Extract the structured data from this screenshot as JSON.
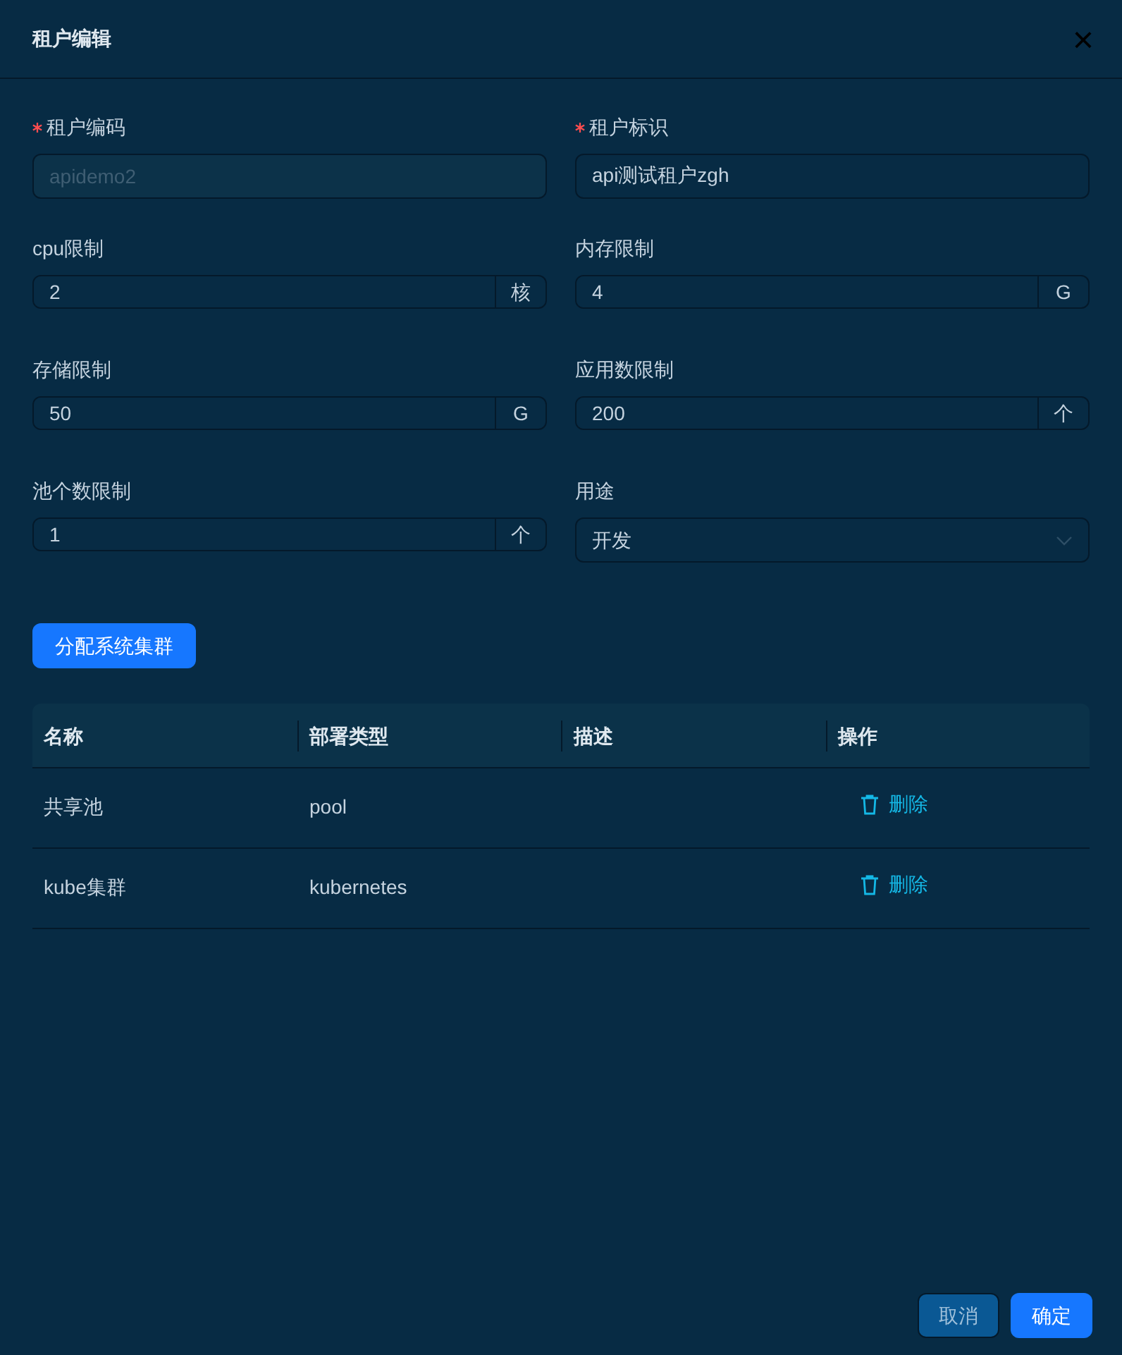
{
  "dialog": {
    "title": "租户编辑",
    "close": "×"
  },
  "fields": [
    {
      "kind": "text",
      "label": "租户编码",
      "required": true,
      "value": "apidemo2",
      "disabled": true
    },
    {
      "kind": "text",
      "label": "租户标识",
      "required": true,
      "value": "api测试租户zgh",
      "disabled": false
    },
    {
      "kind": "addon",
      "label": "cpu限制",
      "required": false,
      "value": "2",
      "suffix": "核"
    },
    {
      "kind": "addon",
      "label": "内存限制",
      "required": false,
      "value": "4",
      "suffix": "G"
    },
    {
      "kind": "addon",
      "label": "存储限制",
      "required": false,
      "value": "50",
      "suffix": "G"
    },
    {
      "kind": "addon",
      "label": "应用数限制",
      "required": false,
      "value": "200",
      "suffix": "个"
    },
    {
      "kind": "addon",
      "label": "池个数限制",
      "required": false,
      "value": "1",
      "suffix": "个"
    },
    {
      "kind": "select",
      "label": "用途",
      "required": false,
      "value": "开发"
    }
  ],
  "assign_button": "分配系统集群",
  "table": {
    "columns": [
      "名称",
      "部署类型",
      "描述",
      "操作"
    ],
    "rows": [
      {
        "name": "共享池",
        "type": "pool",
        "action": "删除"
      },
      {
        "name": "kube集群",
        "type": "kubernetes",
        "action": "删除"
      }
    ]
  },
  "buttons": [
    {
      "label": "取消",
      "kind": "secondary"
    },
    {
      "label": "确定",
      "kind": "primary"
    }
  ]
}
